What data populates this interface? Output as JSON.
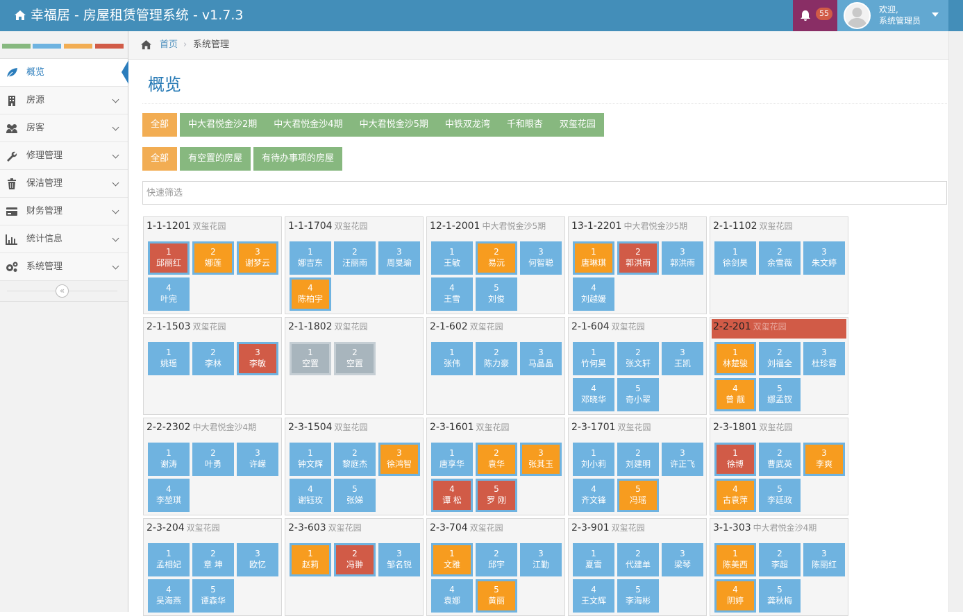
{
  "app": {
    "title": "幸福居 - 房屋租赁管理系统 - v1.7.3",
    "notification_count": "55",
    "welcome": "欢迎,",
    "user": "系统管理员"
  },
  "colors": {
    "topbar": "#438eb9",
    "notif_bg": "#892e65",
    "user_bg": "#62a8d1",
    "room_blue": "#6fb3e0",
    "room_orange": "#f79c1f",
    "room_red": "#d15b47",
    "room_gray": "#a8b5bd",
    "filter_green": "#87b87f",
    "filter_orange": "#f2ad53"
  },
  "sidebar": {
    "items": [
      {
        "label": "概览",
        "icon": "leaf-icon",
        "active": true
      },
      {
        "label": "房源",
        "icon": "building-icon"
      },
      {
        "label": "房客",
        "icon": "users-icon"
      },
      {
        "label": "修理管理",
        "icon": "wrench-icon"
      },
      {
        "label": "保洁管理",
        "icon": "trash-icon"
      },
      {
        "label": "财务管理",
        "icon": "credit-card-icon"
      },
      {
        "label": "统计信息",
        "icon": "bar-chart-icon"
      },
      {
        "label": "系统管理",
        "icon": "cogs-icon"
      }
    ],
    "collapse": "«"
  },
  "breadcrumb": {
    "home": "首页",
    "sep": "›",
    "current": "系统管理"
  },
  "page": {
    "title": "概览"
  },
  "filters": {
    "communities": [
      "全部",
      "中大君悦金沙2期",
      "中大君悦金沙4期",
      "中大君悦金沙5期",
      "中铁双龙湾",
      "千和眼杏",
      "双玺花园"
    ],
    "status": [
      "全部",
      "有空置的房屋",
      "有待办事项的房屋"
    ]
  },
  "search": {
    "placeholder": "快速筛选"
  },
  "houses": [
    {
      "id": "1-1-1201",
      "community": "双玺花园",
      "rooms": [
        [
          "1",
          "邱丽红",
          "red"
        ],
        [
          "2",
          "娜莲",
          "orange"
        ],
        [
          "3",
          "谢梦云",
          "orange"
        ],
        [
          "4",
          "叶完",
          "blue"
        ]
      ]
    },
    {
      "id": "1-1-1704",
      "community": "双玺花园",
      "rooms": [
        [
          "1",
          "娜吉东",
          "blue"
        ],
        [
          "2",
          "汪丽雨",
          "blue"
        ],
        [
          "3",
          "周旻瑜",
          "blue"
        ],
        [
          "4",
          "陈柏宇",
          "orange"
        ]
      ]
    },
    {
      "id": "12-1-2001",
      "community": "中大君悦金沙5期",
      "rooms": [
        [
          "1",
          "王敏",
          "blue"
        ],
        [
          "2",
          "易沅",
          "orange"
        ],
        [
          "3",
          "何智聪",
          "blue"
        ],
        [
          "4",
          "王雪",
          "blue"
        ],
        [
          "5",
          "刘俊",
          "blue"
        ]
      ]
    },
    {
      "id": "13-1-2201",
      "community": "中大君悦金沙5期",
      "rooms": [
        [
          "1",
          "唐琳琪",
          "orange"
        ],
        [
          "2",
          "郭洪雨",
          "red"
        ],
        [
          "3",
          "郭洪雨",
          "blue"
        ],
        [
          "4",
          "刘越媛",
          "blue"
        ]
      ]
    },
    {
      "id": "2-1-1102",
      "community": "双玺花园",
      "rooms": [
        [
          "1",
          "徐剑昊",
          "blue"
        ],
        [
          "2",
          "余雪薇",
          "blue"
        ],
        [
          "3",
          "朱文婷",
          "blue"
        ]
      ]
    },
    {
      "id": "2-1-1503",
      "community": "双玺花园",
      "rooms": [
        [
          "1",
          "姚瑶",
          "blue"
        ],
        [
          "2",
          "李林",
          "blue"
        ],
        [
          "3",
          "李敏",
          "red"
        ]
      ]
    },
    {
      "id": "2-1-1802",
      "community": "双玺花园",
      "rooms": [
        [
          "1",
          "空置",
          "gray"
        ],
        [
          "2",
          "空置",
          "gray"
        ]
      ]
    },
    {
      "id": "2-1-602",
      "community": "双玺花园",
      "rooms": [
        [
          "1",
          "张伟",
          "blue"
        ],
        [
          "2",
          "陈力豪",
          "blue"
        ],
        [
          "3",
          "马晶晶",
          "blue"
        ]
      ]
    },
    {
      "id": "2-1-604",
      "community": "双玺花园",
      "rooms": [
        [
          "1",
          "竹何昊",
          "blue"
        ],
        [
          "2",
          "张文轩",
          "blue"
        ],
        [
          "3",
          "王凯",
          "blue"
        ],
        [
          "4",
          "邓晓华",
          "blue"
        ],
        [
          "5",
          "奇小翠",
          "blue"
        ]
      ]
    },
    {
      "id": "2-2-201",
      "community": "双玺花园",
      "alert": true,
      "rooms": [
        [
          "1",
          "林楚骏",
          "orange"
        ],
        [
          "2",
          "刘福全",
          "blue"
        ],
        [
          "3",
          "杜珍蓉",
          "blue"
        ],
        [
          "4",
          "曾 靓",
          "orange"
        ],
        [
          "5",
          "娜孟钗",
          "blue"
        ]
      ]
    },
    {
      "id": "2-2-2302",
      "community": "中大君悦金沙4期",
      "rooms": [
        [
          "1",
          "谢涛",
          "blue"
        ],
        [
          "2",
          "叶勇",
          "blue"
        ],
        [
          "3",
          "许嵘",
          "blue"
        ],
        [
          "4",
          "李堃琪",
          "blue"
        ]
      ]
    },
    {
      "id": "2-3-1504",
      "community": "双玺花园",
      "rooms": [
        [
          "1",
          "钟文辉",
          "blue"
        ],
        [
          "2",
          "黎庭杰",
          "blue"
        ],
        [
          "3",
          "徐鸿智",
          "orange"
        ],
        [
          "4",
          "谢钰玫",
          "blue"
        ],
        [
          "5",
          "张娣",
          "blue"
        ]
      ]
    },
    {
      "id": "2-3-1601",
      "community": "双玺花园",
      "rooms": [
        [
          "1",
          "唐享华",
          "blue"
        ],
        [
          "2",
          "袁华",
          "orange"
        ],
        [
          "3",
          "张其玉",
          "orange"
        ],
        [
          "4",
          "谭 松",
          "red"
        ],
        [
          "5",
          "罗 刚",
          "red"
        ]
      ]
    },
    {
      "id": "2-3-1701",
      "community": "双玺花园",
      "rooms": [
        [
          "1",
          "刘小莉",
          "blue"
        ],
        [
          "2",
          "刘建明",
          "blue"
        ],
        [
          "3",
          "许正飞",
          "blue"
        ],
        [
          "4",
          "齐文锋",
          "blue"
        ],
        [
          "5",
          "冯瑶",
          "orange"
        ]
      ]
    },
    {
      "id": "2-3-1801",
      "community": "双玺花园",
      "rooms": [
        [
          "1",
          "徐博",
          "red"
        ],
        [
          "2",
          "曹武英",
          "blue"
        ],
        [
          "3",
          "李爽",
          "orange"
        ],
        [
          "4",
          "古袁萍",
          "orange"
        ],
        [
          "5",
          "李廷政",
          "blue"
        ]
      ]
    },
    {
      "id": "2-3-204",
      "community": "双玺花园",
      "rooms": [
        [
          "1",
          "孟相妃",
          "blue"
        ],
        [
          "2",
          "章 坤",
          "blue"
        ],
        [
          "3",
          "欧忆",
          "blue"
        ],
        [
          "4",
          "吴海燕",
          "blue"
        ],
        [
          "5",
          "谭森华",
          "blue"
        ]
      ]
    },
    {
      "id": "2-3-603",
      "community": "双玺花园",
      "rooms": [
        [
          "1",
          "赵莉",
          "orange"
        ],
        [
          "2",
          "冯翀",
          "red"
        ],
        [
          "3",
          "邹名锐",
          "blue"
        ]
      ]
    },
    {
      "id": "2-3-704",
      "community": "双玺花园",
      "rooms": [
        [
          "1",
          "文雅",
          "orange"
        ],
        [
          "2",
          "邱宇",
          "blue"
        ],
        [
          "3",
          "江勤",
          "blue"
        ],
        [
          "4",
          "袁娜",
          "blue"
        ],
        [
          "5",
          "黄丽",
          "orange"
        ]
      ]
    },
    {
      "id": "2-3-901",
      "community": "双玺花园",
      "rooms": [
        [
          "1",
          "夏雪",
          "blue"
        ],
        [
          "2",
          "代建单",
          "blue"
        ],
        [
          "3",
          "梁琴",
          "blue"
        ],
        [
          "4",
          "王文辉",
          "blue"
        ],
        [
          "5",
          "李海彬",
          "blue"
        ]
      ]
    },
    {
      "id": "3-1-303",
      "community": "中大君悦金沙4期",
      "rooms": [
        [
          "1",
          "陈美西",
          "orange"
        ],
        [
          "2",
          "李超",
          "blue"
        ],
        [
          "3",
          "陈丽红",
          "blue"
        ],
        [
          "4",
          "阴婷",
          "orange"
        ],
        [
          "5",
          "龚秋梅",
          "blue"
        ]
      ]
    }
  ]
}
